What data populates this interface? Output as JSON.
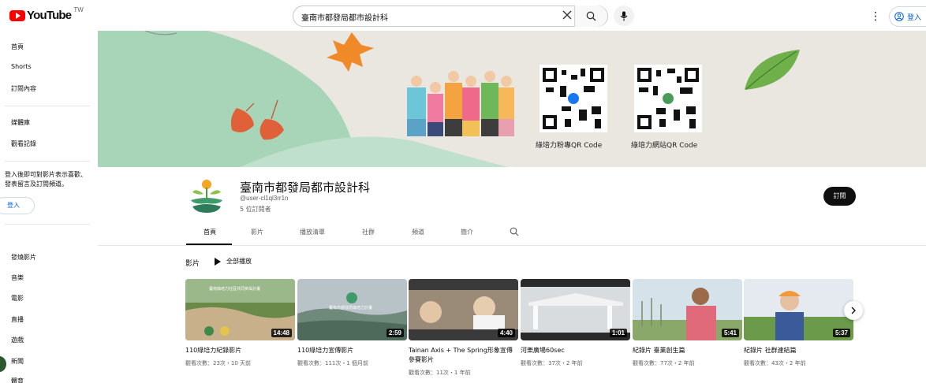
{
  "header": {
    "logo_text": "YouTube",
    "logo_region": "TW",
    "search_value": "臺南市都發局都市設計科",
    "signin_label": "登入"
  },
  "sidebar": {
    "items_top": [
      "首頁",
      "Shorts",
      "訂閱內容"
    ],
    "items_mid": [
      "媒體庫",
      "觀看記錄"
    ],
    "note": "登入後即可對影片表示喜歡、發表留言及訂閱頻道。",
    "signin_label": "登入",
    "explore": [
      "發燒影片",
      "音樂",
      "電影",
      "直播",
      "遊戲",
      "新聞",
      "體育"
    ]
  },
  "banner": {
    "qr_left_caption": "綠培力粉專QR Code",
    "qr_right_caption": "綠培力網站QR Code"
  },
  "channel": {
    "name": "臺南市都發局都市設計科",
    "handle": "@user-cl1ql3rr1n",
    "subscribers": "5 位訂閱者",
    "subscribe_label": "訂閱"
  },
  "tabs": [
    "首頁",
    "影片",
    "播放清單",
    "社群",
    "頻道",
    "簡介"
  ],
  "section": {
    "title": "影片",
    "play_all": "全部播放"
  },
  "videos": [
    {
      "title": "110綠培力紀錄影片",
      "duration": "14:48",
      "meta": "觀看次數：23次・10 天前",
      "thumb_text": "臺南綠培力社區共同參與計畫"
    },
    {
      "title": "110綠培力宣傳影片",
      "duration": "2:59",
      "meta": "觀看次數：111次・1 個月前",
      "thumb_text": "臺南市都發局綠培力計畫"
    },
    {
      "title": "Tainan Axis + The Spring形象宣傳參賽影片",
      "duration": "4:40",
      "meta": "觀看次數：11次・1 年前",
      "thumb_text": ""
    },
    {
      "title": "河樂廣場60sec",
      "duration": "1:01",
      "meta": "觀看次數：37次・2 年前",
      "thumb_text": ""
    },
    {
      "title": "紀錄片 臺業創生篇",
      "duration": "5:41",
      "meta": "觀看次數：77次・2 年前",
      "thumb_text": ""
    },
    {
      "title": "紀錄片 社群連結篇",
      "duration": "5:37",
      "meta": "觀看次數：43次・2 年前",
      "thumb_text": ""
    }
  ],
  "colors": {
    "brand_red": "#ff0000",
    "link_blue": "#065fd4",
    "banner_bg": "#eae7e1",
    "banner_green": "#a8d5b8"
  }
}
